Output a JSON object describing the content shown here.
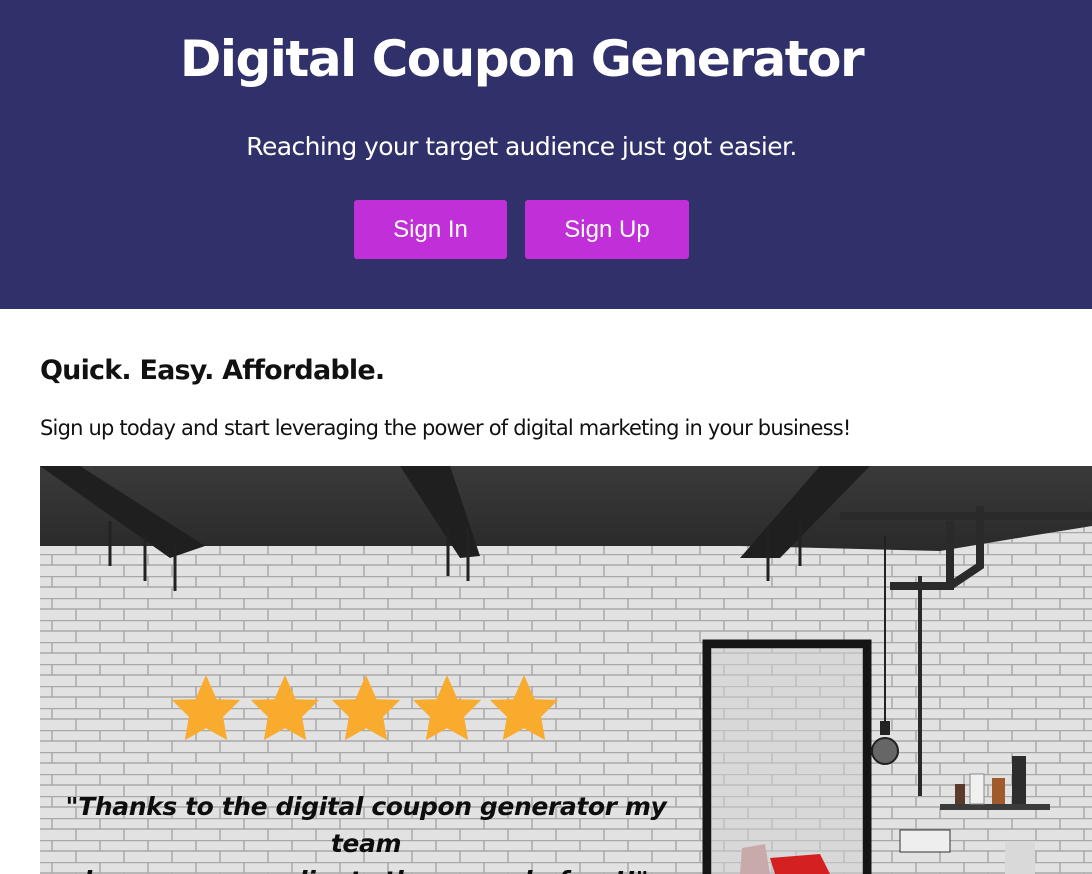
{
  "hero": {
    "title": "Digital Coupon Generator",
    "subtitle": "Reaching your target audience just got easier.",
    "sign_in_label": "Sign In",
    "sign_up_label": "Sign Up"
  },
  "intro": {
    "heading": "Quick. Easy. Affordable.",
    "text": "Sign up today and start leveraging the power of digital marketing in your business!"
  },
  "promo_image": {
    "rating_stars": 5,
    "rating_max": 5,
    "star_icon": "star-icon",
    "quote_line1": "\"Thanks to the digital coupon generator my team",
    "quote_line2": "has more new clients than ever before!!\""
  },
  "colors": {
    "hero_background": "#30306a",
    "button_background": "#c12fd9",
    "star_color": "#f9ab2e"
  }
}
